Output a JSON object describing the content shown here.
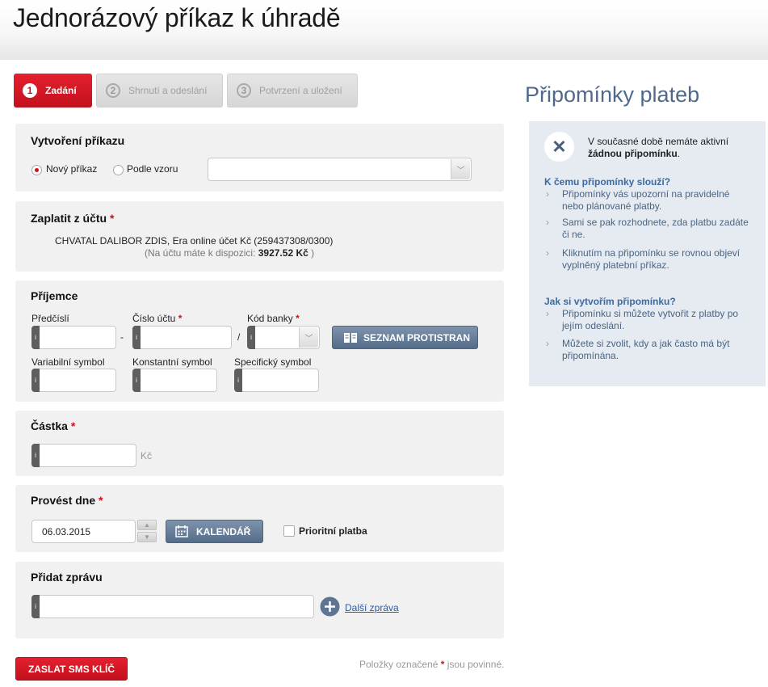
{
  "page": {
    "title": "Jednorázový příkaz k úhradě"
  },
  "steps": [
    {
      "num": "1",
      "label": "Zadání",
      "active": true
    },
    {
      "num": "2",
      "label": "Shrnutí a odeslání",
      "active": false
    },
    {
      "num": "3",
      "label": "Potvrzení a uložení",
      "active": false
    }
  ],
  "create": {
    "title": "Vytvoření příkazu",
    "option_new": "Nový příkaz",
    "option_template": "Podle vzoru",
    "selected": "new"
  },
  "from_account": {
    "title": "Zaplatit z účtu",
    "required": "*",
    "account_line": "CHVATAL DALIBOR ZDIS, Era online účet Kč (259437308/0300)",
    "balance_prefix": "(Na účtu máte k dispozici:",
    "balance_value": "3927.52 Kč",
    "balance_suffix": ")"
  },
  "recipient": {
    "title": "Příjemce",
    "prefix_label": "Předčíslí",
    "dash": "-",
    "account_label": "Číslo účtu",
    "slash": "/",
    "bank_label": "Kód banky",
    "required": "*",
    "list_button": "SEZNAM PROTISTRAN",
    "vs_label": "Variabilní symbol",
    "ks_label": "Konstantní symbol",
    "ss_label": "Specifický symbol",
    "input_tag": "i"
  },
  "amount": {
    "title": "Částka",
    "required": "*",
    "currency": "Kč"
  },
  "date": {
    "title": "Provést dne",
    "required": "*",
    "value": "06.03.2015",
    "calendar_button": "KALENDÁŘ",
    "priority_label": "Prioritní platba",
    "up": "▲",
    "down": "▼"
  },
  "message": {
    "title": "Přidat zprávu",
    "more_link": "Další zpráva"
  },
  "footer": {
    "submit_button": "ZASLAT SMS KLÍČ",
    "note_prefix": "Položky označené",
    "note_star": "*",
    "note_suffix": "jsou povinné."
  },
  "reminders": {
    "title": "Připomínky plateb",
    "empty_line1": "V současné době nemáte aktivní",
    "empty_bold": "žádnou připomínku",
    "empty_end": ".",
    "q1": "K čemu připomínky slouží?",
    "q1_items": [
      "Připomínky vás upozorní na pravidelné nebo plánované platby.",
      "Sami se pak rozhodnete, zda platbu zadáte či ne.",
      "Kliknutím na připomínku se rovnou objeví vyplněný platební příkaz."
    ],
    "q2": "Jak si vytvořím připomínku?",
    "q2_items": [
      "Připomínku si můžete vytvořit z platby po jejím odeslání.",
      "Můžete si zvolit, kdy a jak často má být připomínána."
    ]
  },
  "colors": {
    "accent_red": "#d0101d",
    "button_blue": "#5e7592",
    "side_title": "#50698b",
    "side_bg": "#e5ebf1"
  },
  "icons": {
    "close": "close-icon",
    "book": "book-icon",
    "calendar": "calendar-icon",
    "add": "plus-circle-icon",
    "chevron": "chevron-right-icon"
  }
}
